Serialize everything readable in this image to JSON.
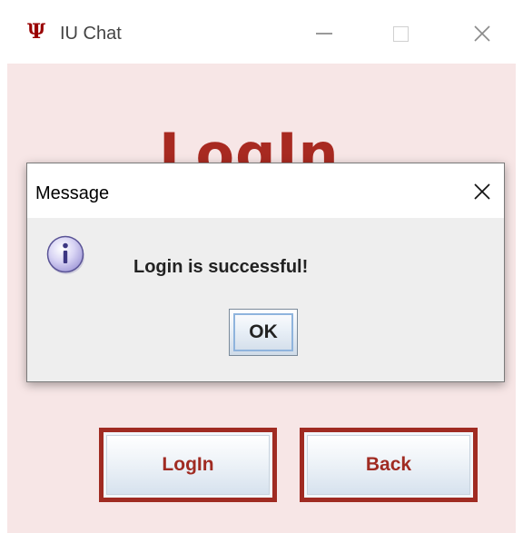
{
  "window": {
    "title": "IU Chat",
    "icon_glyph": "Ψ",
    "icon": "iu-trident-icon",
    "controls": [
      "minimize-icon",
      "maximize-icon",
      "close-icon"
    ]
  },
  "main": {
    "heading": "LogIn",
    "buttons": {
      "login_label": "LogIn",
      "back_label": "Back"
    }
  },
  "dialog": {
    "title": "Message",
    "icon": "info-icon",
    "message": "Login is successful!",
    "ok_label": "OK"
  },
  "colors": {
    "accent": "#a82a21",
    "content_background": "#f7e6e6",
    "dialog_background": "#eeeeee"
  }
}
